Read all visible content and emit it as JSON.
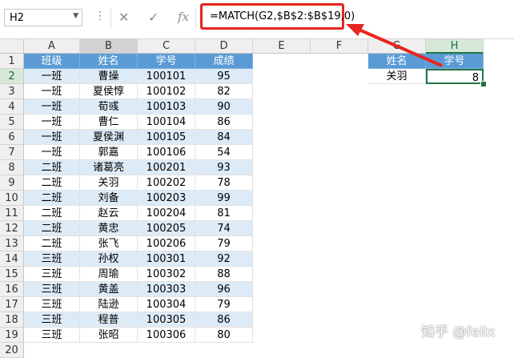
{
  "formula_bar": {
    "name_box": "H2",
    "name_box_arrow": "▼",
    "more_icon": "⋮",
    "cancel_icon": "✕",
    "enter_icon": "✓",
    "fx_label": "fx",
    "formula": "=MATCH(G2,$B$2:$B$19,0)"
  },
  "columns": [
    "A",
    "B",
    "C",
    "D",
    "E",
    "F",
    "G",
    "H"
  ],
  "rows": [
    "1",
    "2",
    "3",
    "4",
    "5",
    "6",
    "7",
    "8",
    "9",
    "10",
    "11",
    "12",
    "13",
    "14",
    "15",
    "16",
    "17",
    "18",
    "19",
    "20"
  ],
  "table": {
    "headers": [
      "班级",
      "姓名",
      "学号",
      "成绩"
    ],
    "rows": [
      [
        "一班",
        "曹操",
        "100101",
        "95"
      ],
      [
        "一班",
        "夏侯惇",
        "100102",
        "82"
      ],
      [
        "一班",
        "荀彧",
        "100103",
        "90"
      ],
      [
        "一班",
        "曹仁",
        "100104",
        "86"
      ],
      [
        "一班",
        "夏侯渊",
        "100105",
        "84"
      ],
      [
        "一班",
        "郭嘉",
        "100106",
        "54"
      ],
      [
        "二班",
        "诸葛亮",
        "100201",
        "93"
      ],
      [
        "二班",
        "关羽",
        "100202",
        "78"
      ],
      [
        "二班",
        "刘备",
        "100203",
        "99"
      ],
      [
        "二班",
        "赵云",
        "100204",
        "81"
      ],
      [
        "二班",
        "黄忠",
        "100205",
        "74"
      ],
      [
        "二班",
        "张飞",
        "100206",
        "79"
      ],
      [
        "三班",
        "孙权",
        "100301",
        "92"
      ],
      [
        "三班",
        "周瑜",
        "100302",
        "88"
      ],
      [
        "三班",
        "黄盖",
        "100303",
        "96"
      ],
      [
        "三班",
        "陆逊",
        "100304",
        "79"
      ],
      [
        "三班",
        "程普",
        "100305",
        "86"
      ],
      [
        "三班",
        "张昭",
        "100306",
        "80"
      ]
    ]
  },
  "lookup": {
    "header_name": "姓名",
    "header_id": "学号",
    "input_name": "关羽",
    "result": "8"
  },
  "colors": {
    "header_fill": "#5b9bd5",
    "band_fill": "#ddebf7",
    "arrow_and_box": "#e8251f",
    "selection": "#217346"
  },
  "watermark": "知乎 @felix"
}
